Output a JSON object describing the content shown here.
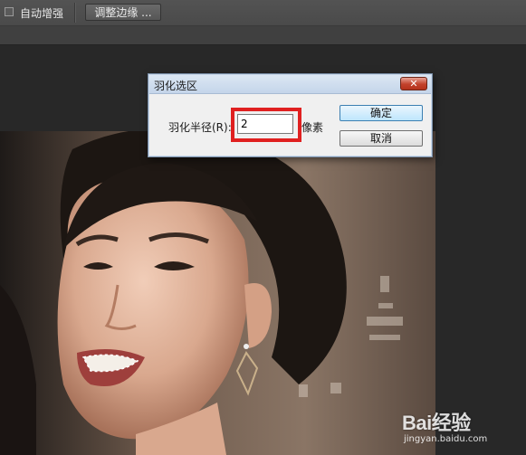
{
  "options_bar": {
    "auto_enhance_label": "自动增强",
    "refine_edge_label": "调整边缘 ..."
  },
  "dialog": {
    "title": "羽化选区",
    "close_label": "✕",
    "radius_label": "羽化半径(R):",
    "radius_value": "2",
    "unit_label": "像素",
    "ok_label": "确定",
    "cancel_label": "取消"
  },
  "watermark": {
    "brand": "Bai经验",
    "url": "jingyan.baidu.com"
  },
  "colors": {
    "highlight": "#e02020",
    "close_button": "#c2412b"
  }
}
